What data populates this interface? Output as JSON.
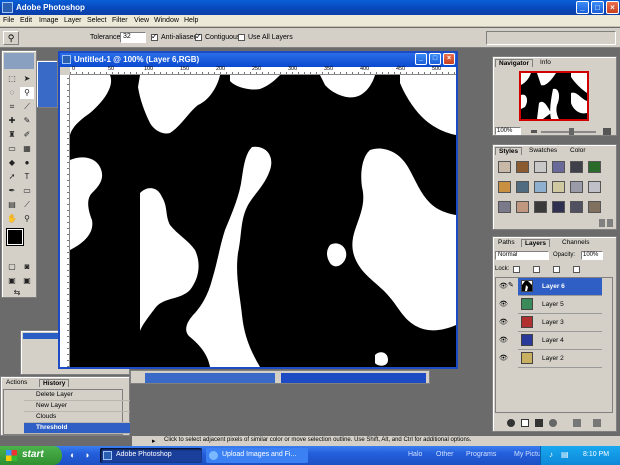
{
  "app": {
    "title": "Adobe Photoshop"
  },
  "menu": [
    "File",
    "Edit",
    "Image",
    "Layer",
    "Select",
    "Filter",
    "View",
    "Window",
    "Help"
  ],
  "options": {
    "tolerance_label": "Tolerance:",
    "tolerance_value": "32",
    "anti_aliased": "Anti-aliased",
    "contiguous": "Contiguous",
    "use_all_layers": "Use All Layers"
  },
  "document": {
    "title": "Untitled-1 @ 100% (Layer 6,RGB)",
    "ruler_ticks": [
      "0",
      "50",
      "100",
      "150",
      "200",
      "250",
      "300",
      "350",
      "400",
      "450",
      "500"
    ]
  },
  "navigator": {
    "tabs": [
      "Navigator",
      "Info"
    ],
    "zoom": "100%"
  },
  "styles": {
    "tabs": [
      "Styles",
      "Swatches",
      "Color"
    ]
  },
  "layers": {
    "tabs": [
      "Paths",
      "Layers",
      "Channels"
    ],
    "blend_mode": "Normal",
    "opacity_label": "Opacity:",
    "opacity_value": "100%",
    "lock_label": "Lock:",
    "items": [
      {
        "name": "Layer 6"
      },
      {
        "name": "Layer 5"
      },
      {
        "name": "Layer 3"
      },
      {
        "name": "Layer 4"
      },
      {
        "name": "Layer 2"
      }
    ]
  },
  "history": {
    "tabs": [
      "Actions",
      "History"
    ],
    "items": [
      "Delete Layer",
      "New Layer",
      "Clouds",
      "Threshold"
    ]
  },
  "status": {
    "text": "Click to select adjacent pixels of similar color or move selection outline. Use Shift, Alt, and Ctrl for additional options."
  },
  "taskbar": {
    "start": "start",
    "tasks": [
      "Adobe Photoshop",
      "Upload Images and Fi..."
    ],
    "quick": [
      "Halo",
      "Other",
      "Programs",
      "My Picture"
    ],
    "clock": "8:10 PM"
  },
  "colors": {
    "accent": "#0a4ad0",
    "panel": "#d4d0c8",
    "selected_layer": "#2f5fc4"
  }
}
